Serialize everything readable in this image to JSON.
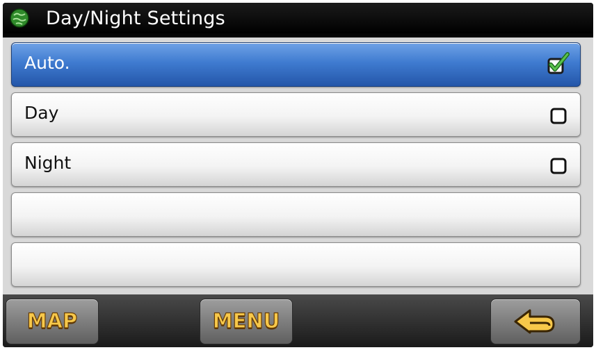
{
  "header": {
    "title": "Day/Night Settings",
    "icon": "globe-icon"
  },
  "options": [
    {
      "label": "Auto.",
      "selected": true,
      "checked": true
    },
    {
      "label": "Day",
      "selected": false,
      "checked": false
    },
    {
      "label": "Night",
      "selected": false,
      "checked": false
    },
    {
      "label": "",
      "selected": false,
      "checked": null
    },
    {
      "label": "",
      "selected": false,
      "checked": null
    }
  ],
  "bottom_bar": {
    "map_label": "MAP",
    "menu_label": "MENU",
    "back_icon": "back-arrow-icon"
  },
  "colors": {
    "accent": "#3f7bd0",
    "button_text": "#f7c84a",
    "check": "#2e8b2e"
  }
}
